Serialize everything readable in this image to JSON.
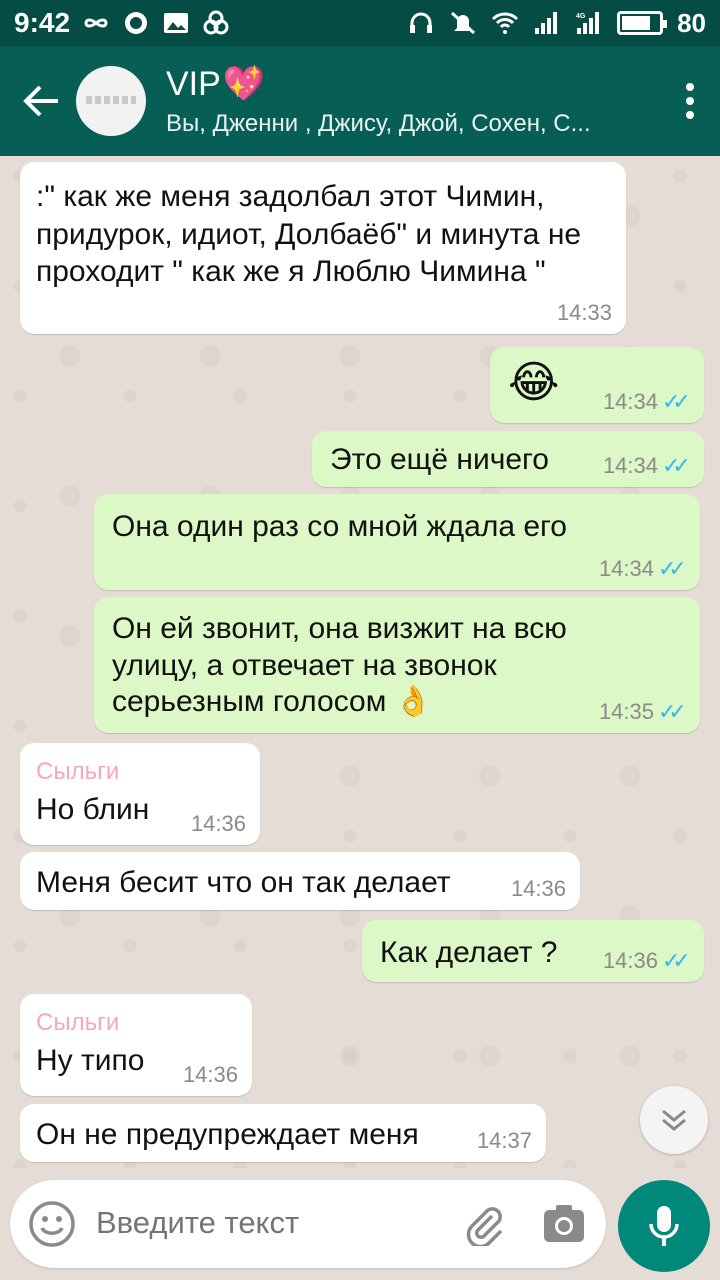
{
  "status_bar": {
    "time": "9:42",
    "battery": "80",
    "battery_fraction": 0.8,
    "icons": [
      "infinity-icon",
      "whatsapp-icon",
      "image-icon",
      "gallery-icon",
      "headset-icon",
      "mute-icon",
      "wifi-icon",
      "signal-icon",
      "signal-4g-icon",
      "battery-icon"
    ],
    "signal_label": "4G"
  },
  "header": {
    "title": "VIP",
    "title_emoji": "💖",
    "members": "Вы, Дженни , Джису, Джой, Сохен, С..."
  },
  "messages": [
    {
      "dir": "in",
      "text": ":\" как же меня задолбал этот Чимин, придурок, идиот, Долбаёб\" и минута не проходит \" как же я Люблю Чимина \"",
      "time": "14:33"
    },
    {
      "dir": "out",
      "text": "😂",
      "time": "14:34"
    },
    {
      "dir": "out",
      "text": "Это ещё ничего",
      "time": "14:34"
    },
    {
      "dir": "out",
      "text": "Она один раз со мной ждала его",
      "time": "14:34"
    },
    {
      "dir": "out",
      "text": "Он ей звонит, она визжит на всю улицу, а отвечает на звонок серьезным голосом 👌",
      "time": "14:35"
    },
    {
      "dir": "in",
      "sender": "Сыльги",
      "text": "Но блин",
      "time": "14:36"
    },
    {
      "dir": "in",
      "text": "Меня бесит что он так делает",
      "time": "14:36"
    },
    {
      "dir": "out",
      "text": "Как делает ?",
      "time": "14:36"
    },
    {
      "dir": "in",
      "sender": "Сыльги",
      "text": "Ну типо",
      "time": "14:36"
    },
    {
      "dir": "in",
      "text": "Он не предупреждает меня",
      "time": "14:37"
    }
  ],
  "read_ticks": "✓✓",
  "input": {
    "placeholder": "Введите текст"
  },
  "colors": {
    "header": "#075e54",
    "status_bar": "#054d44",
    "outgoing_bubble": "#dcf8c6",
    "incoming_bubble": "#ffffff",
    "sender_name": "#f4a7bd",
    "read_tick": "#34b7f1",
    "mic_button": "#00897b"
  }
}
